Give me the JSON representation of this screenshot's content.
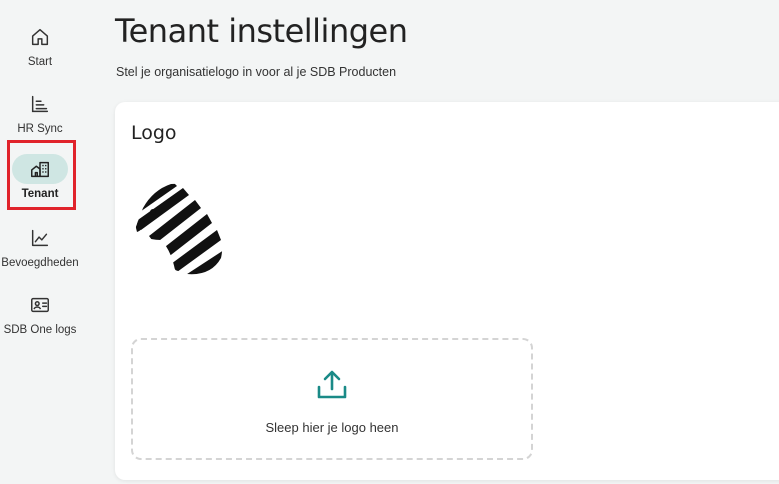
{
  "sidebar": {
    "items": [
      {
        "label": "Start",
        "icon": "home-icon"
      },
      {
        "label": "HR Sync",
        "icon": "bar-list-icon"
      },
      {
        "label": "Tenant",
        "icon": "buildings-icon",
        "active": true
      },
      {
        "label": "Bevoegdheden",
        "icon": "line-chart-icon"
      },
      {
        "label": "SDB One logs",
        "icon": "id-card-icon"
      }
    ]
  },
  "header": {
    "title": "Tenant instellingen",
    "subtitle": "Stel je organisatielogo in voor al je SDB Producten"
  },
  "logo_card": {
    "title": "Logo",
    "preview_icon": "zebra-logo-image",
    "dropzone_label": "Sleep hier je logo heen",
    "upload_icon": "upload-icon"
  },
  "colors": {
    "background": "#f3f5f5",
    "accent": "#1a8a87",
    "active_pill": "#cfe6e3",
    "highlight": "#e0232b"
  }
}
